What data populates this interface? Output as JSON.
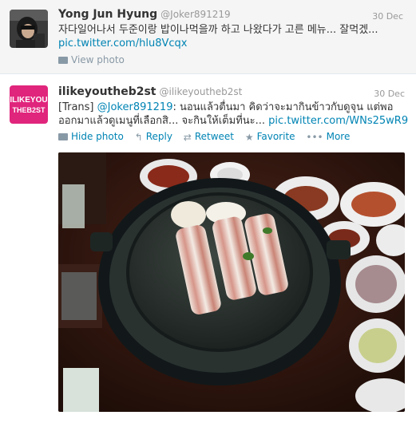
{
  "tweets": [
    {
      "name": "Yong Jun Hyung",
      "handle": "@Joker891219",
      "date": "30 Dec",
      "text": "자다일어나서 두준이랑 밥이나먹을까 하고 나왔다가 고른 메뉴... 잘먹겠...",
      "link": "pic.twitter.com/hlu8Vcqx",
      "actions": {
        "view_photo": "View photo"
      }
    },
    {
      "name": "ilikeyoutheb2st",
      "handle": "@ilikeyoutheb2st",
      "date": "30 Dec",
      "text_prefix": "[Trans] ",
      "mention": "@Joker891219",
      "text": ": นอนแล้วตื่นมา คิดว่าจะมากินข้าวกับดูจุน แต่พอออกมาแล้วดูเมนูที่เลือกสิ... จะกินให้เต็มที่นะ...",
      "link": "pic.twitter.com/WNs25wR9",
      "avatar_text": {
        "line1": "ILIKEYOU",
        "line2": "THEB2ST"
      },
      "actions": {
        "hide_photo": "Hide photo",
        "reply": "Reply",
        "retweet": "Retweet",
        "favorite": "Favorite",
        "more": "More"
      }
    }
  ],
  "colors": {
    "link": "#0084b4",
    "muted": "#999999",
    "avatar_pink": "#e0257c"
  },
  "icons": [
    "photo-icon",
    "reply-icon",
    "retweet-icon",
    "favorite-icon",
    "more-icon"
  ]
}
